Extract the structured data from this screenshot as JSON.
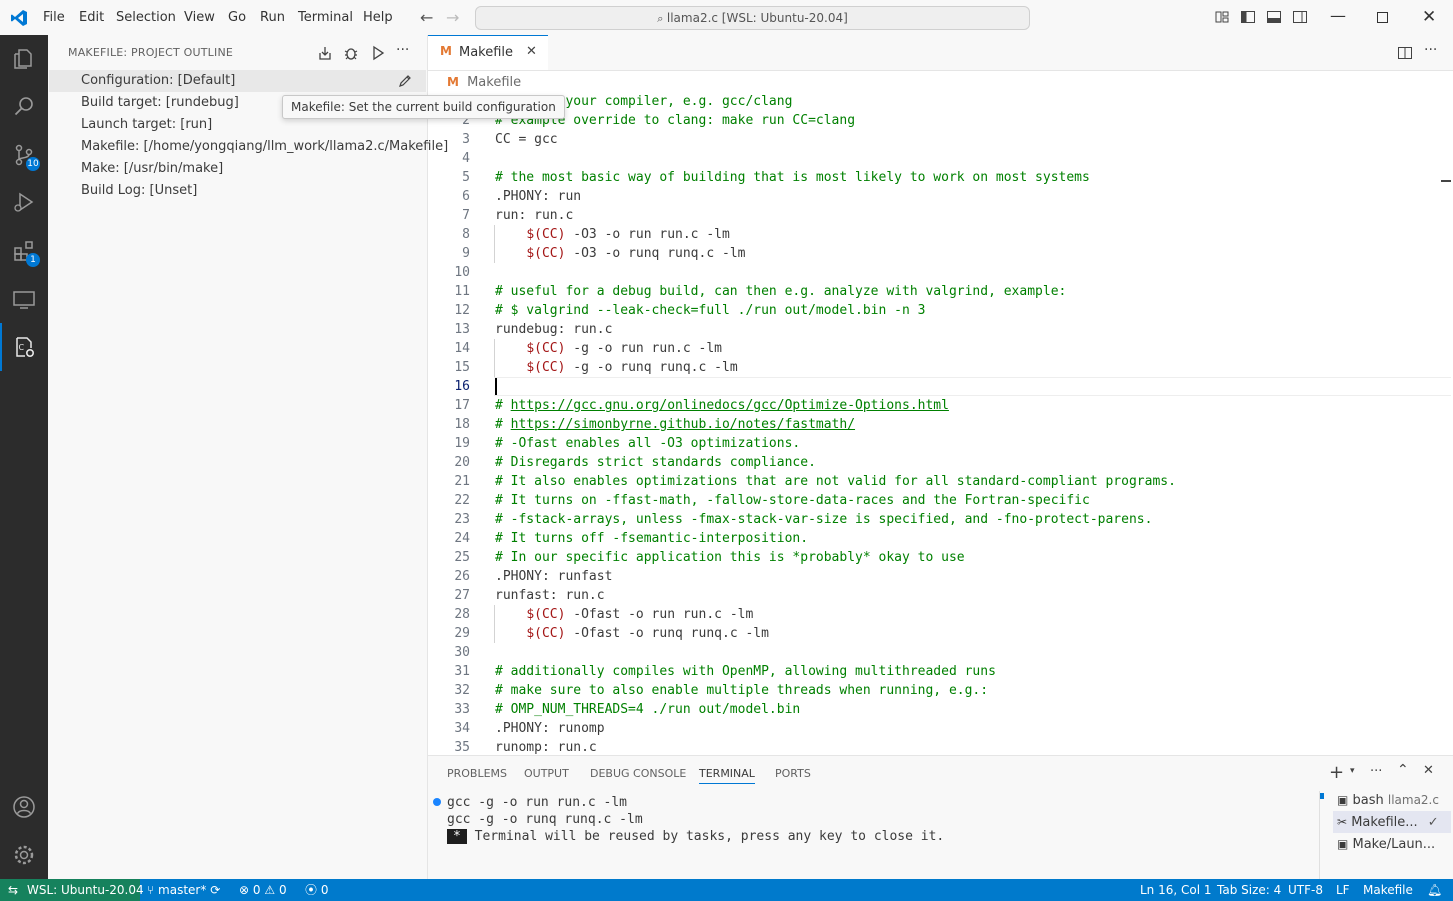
{
  "window": {
    "menu": [
      "File",
      "Edit",
      "Selection",
      "View",
      "Go",
      "Run",
      "Terminal",
      "Help"
    ],
    "command_center": "llama2.c [WSL: Ubuntu-20.04]"
  },
  "activity_bar": {
    "source_control_badge": "10",
    "extensions_badge": "1"
  },
  "sidebar": {
    "title": "MAKEFILE: PROJECT OUTLINE",
    "items": [
      {
        "label": "Configuration: [Default]"
      },
      {
        "label": "Build target: [rundebug]"
      },
      {
        "label": "Launch target: [run]"
      },
      {
        "label": "Makefile: [/home/yongqiang/llm_work/llama2.c/Makefile]"
      },
      {
        "label": "Make: [/usr/bin/make]"
      },
      {
        "label": "Build Log: [Unset]"
      }
    ],
    "tooltip": "Makefile: Set the current build configuration"
  },
  "editor": {
    "tab_label": "Makefile",
    "breadcrumb": "Makefile",
    "lines": [
      {
        "n": "1",
        "segs": [
          [
            "cmt",
            "# choose your compiler, e.g. gcc/clang"
          ]
        ]
      },
      {
        "n": "2",
        "segs": [
          [
            "cmt",
            "# example override to clang: make run CC=clang"
          ]
        ]
      },
      {
        "n": "3",
        "segs": [
          [
            "",
            "CC = gcc"
          ]
        ]
      },
      {
        "n": "4",
        "segs": []
      },
      {
        "n": "5",
        "segs": [
          [
            "cmt",
            "# the most basic way of building that is most likely to work on most systems"
          ]
        ]
      },
      {
        "n": "6",
        "segs": [
          [
            "",
            ".PHONY: run"
          ]
        ]
      },
      {
        "n": "7",
        "segs": [
          [
            "",
            "run: run.c"
          ]
        ]
      },
      {
        "n": "8",
        "segs": [
          [
            "",
            "    "
          ],
          [
            "var",
            "$(CC)"
          ],
          [
            "",
            " -O3 -o run run.c -lm"
          ]
        ]
      },
      {
        "n": "9",
        "segs": [
          [
            "",
            "    "
          ],
          [
            "var",
            "$(CC)"
          ],
          [
            "",
            " -O3 -o runq runq.c -lm"
          ]
        ]
      },
      {
        "n": "10",
        "segs": []
      },
      {
        "n": "11",
        "segs": [
          [
            "cmt",
            "# useful for a debug build, can then e.g. analyze with valgrind, example:"
          ]
        ]
      },
      {
        "n": "12",
        "segs": [
          [
            "cmt",
            "# $ valgrind --leak-check=full ./run out/model.bin -n 3"
          ]
        ]
      },
      {
        "n": "13",
        "segs": [
          [
            "",
            "rundebug: run.c"
          ]
        ]
      },
      {
        "n": "14",
        "segs": [
          [
            "",
            "    "
          ],
          [
            "var",
            "$(CC)"
          ],
          [
            "",
            " -g -o run run.c -lm"
          ]
        ]
      },
      {
        "n": "15",
        "segs": [
          [
            "",
            "    "
          ],
          [
            "var",
            "$(CC)"
          ],
          [
            "",
            " -g -o runq runq.c -lm"
          ]
        ]
      },
      {
        "n": "16",
        "segs": []
      },
      {
        "n": "17",
        "segs": [
          [
            "cmt",
            "# "
          ],
          [
            "lnk",
            "https://gcc.gnu.org/onlinedocs/gcc/Optimize-Options.html"
          ]
        ]
      },
      {
        "n": "18",
        "segs": [
          [
            "cmt",
            "# "
          ],
          [
            "lnk",
            "https://simonbyrne.github.io/notes/fastmath/"
          ]
        ]
      },
      {
        "n": "19",
        "segs": [
          [
            "cmt",
            "# -Ofast enables all -O3 optimizations."
          ]
        ]
      },
      {
        "n": "20",
        "segs": [
          [
            "cmt",
            "# Disregards strict standards compliance."
          ]
        ]
      },
      {
        "n": "21",
        "segs": [
          [
            "cmt",
            "# It also enables optimizations that are not valid for all standard-compliant programs."
          ]
        ]
      },
      {
        "n": "22",
        "segs": [
          [
            "cmt",
            "# It turns on -ffast-math, -fallow-store-data-races and the Fortran-specific"
          ]
        ]
      },
      {
        "n": "23",
        "segs": [
          [
            "cmt",
            "# -fstack-arrays, unless -fmax-stack-var-size is specified, and -fno-protect-parens."
          ]
        ]
      },
      {
        "n": "24",
        "segs": [
          [
            "cmt",
            "# It turns off -fsemantic-interposition."
          ]
        ]
      },
      {
        "n": "25",
        "segs": [
          [
            "cmt",
            "# In our specific application this is *probably* okay to use"
          ]
        ]
      },
      {
        "n": "26",
        "segs": [
          [
            "",
            ".PHONY: runfast"
          ]
        ]
      },
      {
        "n": "27",
        "segs": [
          [
            "",
            "runfast: run.c"
          ]
        ]
      },
      {
        "n": "28",
        "segs": [
          [
            "",
            "    "
          ],
          [
            "var",
            "$(CC)"
          ],
          [
            "",
            " -Ofast -o run run.c -lm"
          ]
        ]
      },
      {
        "n": "29",
        "segs": [
          [
            "",
            "    "
          ],
          [
            "var",
            "$(CC)"
          ],
          [
            "",
            " -Ofast -o runq runq.c -lm"
          ]
        ]
      },
      {
        "n": "30",
        "segs": []
      },
      {
        "n": "31",
        "segs": [
          [
            "cmt",
            "# additionally compiles with OpenMP, allowing multithreaded runs"
          ]
        ]
      },
      {
        "n": "32",
        "segs": [
          [
            "cmt",
            "# make sure to also enable multiple threads when running, e.g.:"
          ]
        ]
      },
      {
        "n": "33",
        "segs": [
          [
            "cmt",
            "# OMP_NUM_THREADS=4 ./run out/model.bin"
          ]
        ]
      },
      {
        "n": "34",
        "segs": [
          [
            "",
            ".PHONY: runomp"
          ]
        ]
      },
      {
        "n": "35",
        "segs": [
          [
            "",
            "runomp: run.c"
          ]
        ]
      }
    ]
  },
  "panel": {
    "tabs": [
      "PROBLEMS",
      "OUTPUT",
      "DEBUG CONSOLE",
      "TERMINAL",
      "PORTS"
    ],
    "terminal_lines": [
      "gcc -g -o run run.c -lm",
      "gcc -g -o runq runq.c -lm",
      "Terminal will be reused by tasks, press any key to close it."
    ],
    "terminal_star": "*",
    "terminals": [
      {
        "name": "bash",
        "detail": "llama2.c"
      },
      {
        "name": "Makefile...",
        "detail": ""
      },
      {
        "name": "Make/Laun...",
        "detail": ""
      }
    ]
  },
  "statusbar": {
    "remote": "WSL: Ubuntu-20.04",
    "branch": "master*",
    "errors": "0",
    "warnings": "0",
    "ports": "0",
    "position": "Ln 16, Col 1",
    "tab_size": "Tab Size: 4",
    "encoding": "UTF-8",
    "eol": "LF",
    "language": "Makefile"
  },
  "colors": {
    "accent": "#0078d4",
    "status_bar": "#007acc",
    "remote": "#16825d",
    "comment": "#008000",
    "variable": "#a31515"
  }
}
